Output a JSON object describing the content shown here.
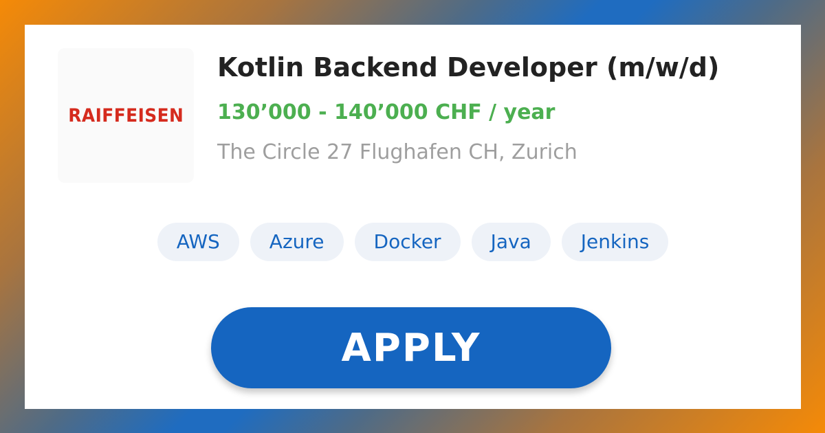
{
  "company": {
    "logo_text": "RAIFFEISEN",
    "logo_color": "#d52b1e"
  },
  "job": {
    "title": "Kotlin Backend Developer (m/w/d)",
    "salary": "130’000 - 140’000 CHF / year",
    "location": "The Circle 27 Flughafen CH, Zurich"
  },
  "tags": [
    "AWS",
    "Azure",
    "Docker",
    "Java",
    "Jenkins"
  ],
  "apply": {
    "label": "APPLY"
  },
  "colors": {
    "accent": "#1565c0",
    "salary": "#4caf50",
    "gradient_orange": "#f58a07",
    "gradient_blue": "#1f6cc0"
  }
}
